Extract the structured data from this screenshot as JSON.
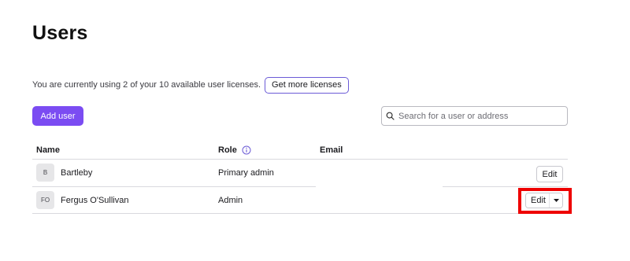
{
  "header": {
    "title": "Users"
  },
  "licenses": {
    "text": "You are currently using 2 of your 10 available user licenses.",
    "button_label": "Get more licenses"
  },
  "toolbar": {
    "add_user_label": "Add user"
  },
  "search": {
    "placeholder": "Search for a user or address",
    "value": ""
  },
  "table": {
    "columns": {
      "name": "Name",
      "role": "Role",
      "email": "Email"
    },
    "rows": [
      {
        "initials": "B",
        "name": "Bartleby",
        "role": "Primary admin",
        "email": "",
        "action": "Edit"
      },
      {
        "initials": "FO",
        "name": "Fergus O'Sullivan",
        "role": "Admin",
        "email": "",
        "action": "Edit"
      }
    ]
  },
  "colors": {
    "accent": "#7b4cf2",
    "highlight": "#ee0000"
  }
}
